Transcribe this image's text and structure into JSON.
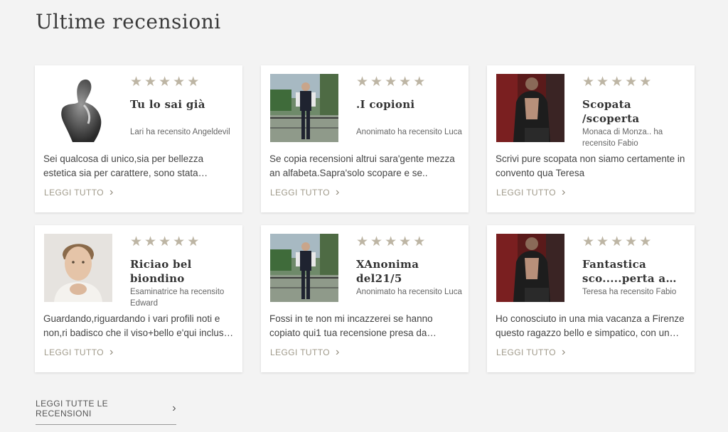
{
  "header": {
    "title": "Ultime recensioni"
  },
  "reviews": [
    {
      "rating": 5,
      "title": "Tu lo sai già",
      "meta": "Lari ha recensito Angeldevil",
      "excerpt": "Sei qualcosa di unico,sia per bellezza estetica sia per carattere, sono stata…",
      "read_more": "LEGGI TUTTO"
    },
    {
      "rating": 5,
      "title": ".I copioni",
      "meta": "Anonimato ha recensito Luca",
      "excerpt": "Se copia recensioni altrui sara'gente mezza an alfabeta.Sapra'solo scopare e se..",
      "read_more": "LEGGI TUTTO"
    },
    {
      "rating": 5,
      "title": "Scopata /scoperta",
      "meta": "Monaca di Monza.. ha recensito Fabio",
      "excerpt": "Scrivi pure scopata non siamo certamente in convento qua Teresa",
      "read_more": "LEGGI TUTTO"
    },
    {
      "rating": 5,
      "title": "Riciao bel biondino",
      "meta": "Esaminatrice ha recensito Edward",
      "excerpt": "Guardando,riguardando i vari profili noti e non,ri badisco che il viso+bello e'qui inclus…",
      "read_more": "LEGGI TUTTO"
    },
    {
      "rating": 5,
      "title": "XAnonima del21/5",
      "meta": "Anonimato ha recensito Luca",
      "excerpt": "Fossi in te non mi incazzerei se hanno copiato qui1 tua recensione presa da…",
      "read_more": "LEGGI TUTTO"
    },
    {
      "rating": 5,
      "title": "Fantastica sco.....perta a…",
      "meta": "Teresa ha recensito Fabio",
      "excerpt": "Ho conosciuto in una mia vacanza a Firenze questo ragazzo bello e simpatico, con un…",
      "read_more": "LEGGI TUTTO"
    }
  ],
  "footer": {
    "all_reviews": "LEGGI TUTTE LE RECENSIONI"
  },
  "colors": {
    "star": "#bdb5a4",
    "link": "#a09a8a",
    "background": "#f3f3f3"
  }
}
